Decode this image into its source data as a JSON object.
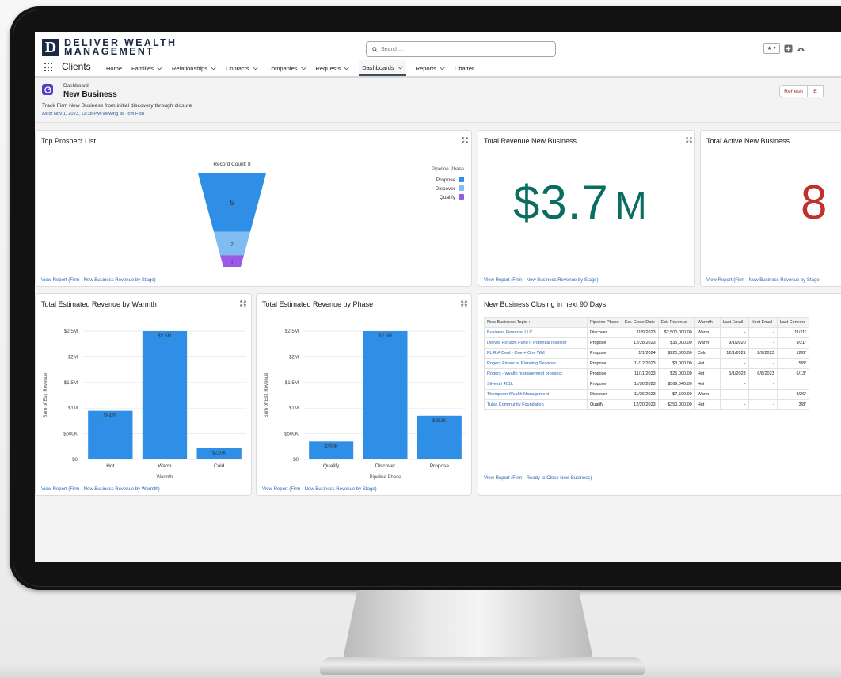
{
  "brand": {
    "mark": "D",
    "line1": "DELIVER WEALTH",
    "line2": "MANAGEMENT"
  },
  "search": {
    "placeholder": "Search..."
  },
  "nav": {
    "app_name": "Clients",
    "items": [
      {
        "label": "Home",
        "dropdown": false
      },
      {
        "label": "Families",
        "dropdown": true
      },
      {
        "label": "Relationships",
        "dropdown": true
      },
      {
        "label": "Contacts",
        "dropdown": true
      },
      {
        "label": "Companies",
        "dropdown": true
      },
      {
        "label": "Requests",
        "dropdown": true
      },
      {
        "label": "Dashboards",
        "dropdown": true,
        "active": true
      },
      {
        "label": "Reports",
        "dropdown": true
      },
      {
        "label": "Chatter",
        "dropdown": false
      }
    ]
  },
  "dashboard": {
    "type": "Dashboard",
    "title": "New Business",
    "description": "Track Firm New Business from initial discovery through closure",
    "as_of": "As of Nov 1, 2023, 12:38 PM·Viewing as Tom Fish",
    "refresh_label": "Refresh",
    "edit_label": "E"
  },
  "cards": {
    "top_prospects": {
      "title": "Top Prospect List",
      "link": "View Report (Firm - New Business Revenue by Stage)"
    },
    "total_revenue": {
      "title": "Total Revenue New Business",
      "value": "$3.7",
      "suffix": "M",
      "link": "View Report (Firm - New Business Revenue by Stage)"
    },
    "total_active": {
      "title": "Total Active New Business",
      "value": "8",
      "link": "View Report (Firm - New Business Revenue by Stage)"
    },
    "by_warmth": {
      "title": "Total Estimated Revenue by Warmth",
      "link": "View Report (Firm - New Business Revenue by Warmth)"
    },
    "by_phase": {
      "title": "Total Estimated Revenue by Phase",
      "link": "View Report (Firm - New Business Revenue by Stage)"
    },
    "closing": {
      "title": "New Business Closing in next 90 Days",
      "link": "View Report (Firm - Ready to Close New Business)",
      "columns": [
        "New Business: Topic ↑",
        "Pipeline Phase",
        "Est. Close Date",
        "Est. Revenue",
        "Warmth",
        "Last Email",
        "Next Email",
        "Last Convers"
      ],
      "rows": [
        [
          "Business Financial LLC",
          "Discover",
          "11/9/2023",
          "$2,500,000.00",
          "Warm",
          "-",
          "-",
          "11/11/"
        ],
        [
          "Deliver Horizon Fund I- Potential Investor",
          "Propose",
          "12/28/2023",
          "$35,000.00",
          "Warm",
          "9/1/2020",
          "-",
          "9/21/"
        ],
        [
          "FL RIA Deal - One + One WM",
          "Propose",
          "1/1/2024",
          "$220,000.00",
          "Cold",
          "12/1/2021",
          "2/2/2023",
          "12/8/"
        ],
        [
          "Rogers Financial Planning Services",
          "Propose",
          "11/12/2023",
          "$3,000.00",
          "Hot",
          "-",
          "-",
          "5/8/"
        ],
        [
          "Rogers - wealth management prospect",
          "Propose",
          "11/11/2023",
          "$25,000.00",
          "Hot",
          "6/1/2023",
          "6/8/2023",
          "6/13/"
        ],
        [
          "Silvestri 401k",
          "Propose",
          "11/30/2023",
          "$569,040.00",
          "Hot",
          "-",
          "-",
          ""
        ],
        [
          "Thompson Wealth Management",
          "Discover",
          "11/26/2023",
          "$7,500.00",
          "Warm",
          "-",
          "-",
          "8/26/"
        ],
        [
          "Tulsa Community Foundation",
          "Qualify",
          "12/20/2023",
          "$350,000.00",
          "Hot",
          "-",
          "-",
          "3/8/"
        ]
      ]
    }
  },
  "colors": {
    "accent_blue": "#2f8fe6",
    "funnel_propose": "#2f8fe6",
    "funnel_discover": "#7fbcf2",
    "funnel_qualify": "#9a5ae8",
    "metric_teal": "#0b6d62",
    "metric_red": "#c0312b"
  },
  "chart_data": [
    {
      "type": "funnel",
      "title": "Record Count: 8",
      "legend_title": "Pipeline Phase",
      "legend_position": "top-right",
      "categories": [
        "Propose",
        "Discover",
        "Qualify"
      ],
      "values": [
        5,
        2,
        1
      ]
    },
    {
      "type": "bar",
      "categories": [
        "Hot",
        "Warm",
        "Cold"
      ],
      "values": [
        947000,
        2500000,
        220000
      ],
      "value_labels": [
        "$947K",
        "$2.5M",
        "$220K"
      ],
      "xlabel": "Warmth",
      "ylabel": "Sum of Est. Revenue",
      "ylim": [
        0,
        2500000
      ],
      "ticks": [
        0,
        500000,
        1000000,
        1500000,
        2000000,
        2500000
      ],
      "tick_labels": [
        "$0",
        "$500K",
        "$1M",
        "$1.5M",
        "$2M",
        "$2.5M"
      ],
      "grid": true
    },
    {
      "type": "bar",
      "categories": [
        "Qualify",
        "Discover",
        "Propose"
      ],
      "values": [
        350000,
        2500000,
        852000
      ],
      "value_labels": [
        "$350K",
        "$2.5M",
        "$852K"
      ],
      "xlabel": "Pipeline Phase",
      "ylabel": "Sum of Est. Revenue",
      "ylim": [
        0,
        2500000
      ],
      "ticks": [
        0,
        500000,
        1000000,
        1500000,
        2000000,
        2500000
      ],
      "tick_labels": [
        "$0",
        "$500K",
        "$1M",
        "$1.5M",
        "$2M",
        "$2.5M"
      ],
      "grid": true
    }
  ]
}
